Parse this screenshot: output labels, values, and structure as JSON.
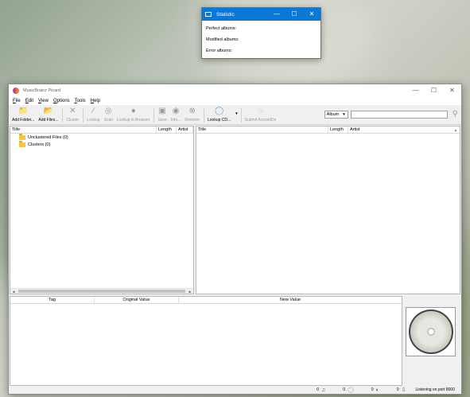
{
  "statistic_window": {
    "title": "Statistic",
    "controls": {
      "minimize": "—",
      "maximize": "☐",
      "close": "✕"
    },
    "rows": [
      {
        "label": "Perfect albums:"
      },
      {
        "label": "Modified albums:"
      },
      {
        "label": "Error albums:"
      }
    ]
  },
  "main_window": {
    "title": "MusicBrainz Picard",
    "controls": {
      "minimize": "—",
      "maximize": "☐",
      "close": "✕"
    },
    "menu": [
      "File",
      "Edit",
      "View",
      "Options",
      "Tools",
      "Help"
    ],
    "toolbar": {
      "buttons": [
        {
          "label": "Add Folder...",
          "icon": "folder-add-icon",
          "glyph": "📁",
          "enabled": true
        },
        {
          "label": "Add Files...",
          "icon": "file-add-icon",
          "glyph": "📂",
          "enabled": true
        },
        {
          "label": "Cluster",
          "icon": "cluster-icon",
          "glyph": "✕",
          "enabled": false
        },
        {
          "label": "Lookup",
          "icon": "lookup-icon",
          "glyph": "⁄",
          "enabled": false
        },
        {
          "label": "Scan",
          "icon": "scan-icon",
          "glyph": "◎",
          "enabled": false
        },
        {
          "label": "Lookup in Browser",
          "icon": "browser-icon",
          "glyph": "●",
          "enabled": false
        },
        {
          "label": "Save",
          "icon": "save-icon",
          "glyph": "▣",
          "enabled": false
        },
        {
          "label": "Info...",
          "icon": "info-icon",
          "glyph": "◉",
          "enabled": false
        },
        {
          "label": "Remove",
          "icon": "remove-icon",
          "glyph": "⊗",
          "enabled": false
        },
        {
          "label": "Lookup CD...",
          "icon": "cd-icon",
          "glyph": "◯",
          "enabled": true
        },
        {
          "label": "Submit AcoustIDs",
          "icon": "submit-icon",
          "glyph": "◌",
          "enabled": false
        }
      ],
      "search_type": "Album",
      "search_value": "",
      "search_placeholder": ""
    },
    "left_pane": {
      "columns": [
        "Title",
        "Length",
        "Artist"
      ],
      "items": [
        {
          "label": "Unclustered Files (0)"
        },
        {
          "label": "Clusters (0)"
        }
      ]
    },
    "right_pane": {
      "columns": [
        "Title",
        "Length",
        "Artist"
      ]
    },
    "tag_table": {
      "columns": [
        "Tag",
        "Original Value",
        "New Value"
      ]
    },
    "status_bar": {
      "counts": [
        {
          "value": "0",
          "icon": "file-count-icon",
          "glyph": "♫"
        },
        {
          "value": "0",
          "icon": "disc-count-icon",
          "glyph": "◯"
        },
        {
          "value": "0",
          "icon": "pending-icon",
          "glyph": "◐"
        },
        {
          "value": "0",
          "icon": "download-icon",
          "glyph": "⇩"
        }
      ],
      "message": "Listening on port 8000"
    }
  }
}
